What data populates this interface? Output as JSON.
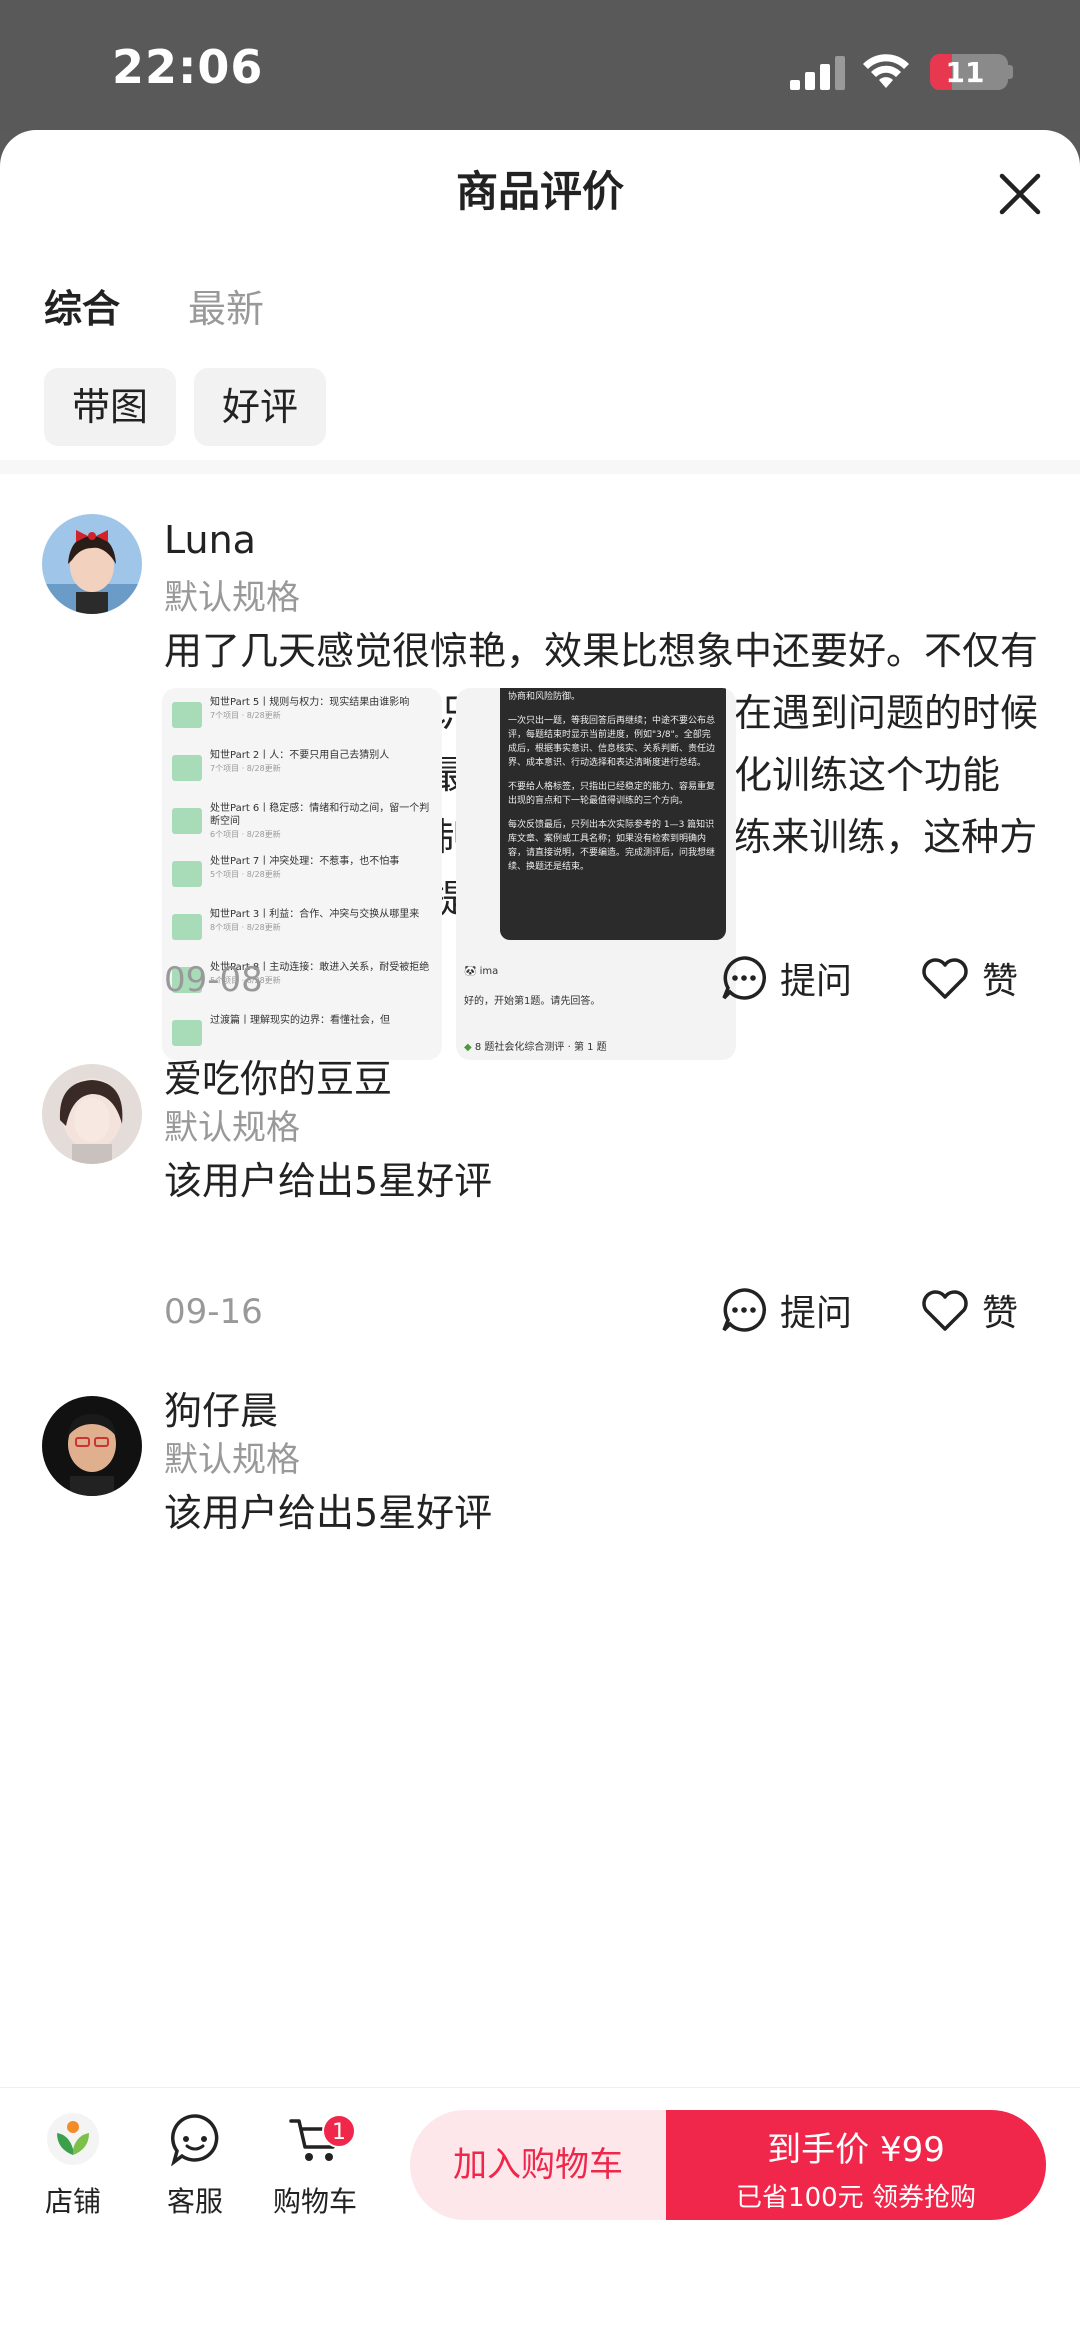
{
  "status_bar": {
    "time": "22:06",
    "battery": "11"
  },
  "header": {
    "title": "商品评价"
  },
  "tabs": [
    {
      "label": "综合"
    },
    {
      "label": "最新"
    }
  ],
  "filters": [
    {
      "label": "带图"
    },
    {
      "label": "好评"
    }
  ],
  "reviews": [
    {
      "user": "Luna",
      "spec": "默认规格",
      "text": "用了几天感觉很惊艳，效果比想象中还要好。不仅有系统的社会化知识可以阅读，还能在遇到问题的时候向知识库提问。最喜欢的就是社会化训练这个功能了，可以一键复制提示词让AI做教练来训练，这种方法可以比较快的提升自己的社会",
      "expand": "展开",
      "date": "09-08",
      "ask": "提问",
      "like": "赞",
      "thumb1": [
        {
          "title": "知世Part 5丨规则与权力：现实结果由谁影响",
          "meta": "7个项目 · 8/28更新"
        },
        {
          "title": "知世Part 2丨人：不要只用自己去猜别人",
          "meta": "7个项目 · 8/28更新"
        },
        {
          "title": "处世Part 6丨稳定感：情绪和行动之间，留一个判断空间",
          "meta": "6个项目 · 8/28更新"
        },
        {
          "title": "处世Part 7丨冲突处理：不惹事，也不怕事",
          "meta": "5个项目 · 8/28更新"
        },
        {
          "title": "知世Part 3丨利益：合作、冲突与交换从哪里来",
          "meta": "8个项目 · 8/28更新"
        },
        {
          "title": "处世Part 8丨主动连接：敢进入关系，耐受被拒绝",
          "meta": "5个项目 · 8/28更新"
        },
        {
          "title": "过渡篇丨理解现实的边界：看懂社会，但",
          "meta": ""
        }
      ],
      "thumb2": {
        "top": "协商和风险防御。",
        "p1": "一次只出一题，等我回答后再继续；中途不要公布总评，每题结束时显示当前进度，例如\"3/8\"。全部完成后，根据事实意识、信息核实、关系判断、责任边界、成本意识、行动选择和表达清晰度进行总结。",
        "p2": "不要给人格标签，只指出已经稳定的能力、容易重复出现的盲点和下一轮最值得训练的三个方向。",
        "p3": "每次反馈最后，只列出本次实际参考的 1—3 篇知识库文章、案例或工具名称；如果没有检索到明确内容，请直接说明，不要编造。完成测评后，问我想继续、换题还是结束。",
        "bot": "ima",
        "reply": "好的，开始第1题。请先回答。",
        "footer": "8 题社会化综合测评 · 第 1 题"
      }
    },
    {
      "user": "爱吃你的豆豆",
      "spec": "默认规格",
      "text": "该用户给出5星好评",
      "date": "09-16",
      "ask": "提问",
      "like": "赞"
    },
    {
      "user": "狗仔晨",
      "spec": "默认规格",
      "text": "该用户给出5星好评"
    }
  ],
  "bottom_bar": {
    "store": "店铺",
    "service": "客服",
    "cart": "购物车",
    "cart_badge": "1",
    "add_to_cart": "加入购物车",
    "price_label": "到手价 ¥99",
    "price_sub": "已省100元 领券抢购"
  },
  "colors": {
    "accent": "#f0274a",
    "accent_light": "#fde7ea",
    "muted": "#999999"
  }
}
